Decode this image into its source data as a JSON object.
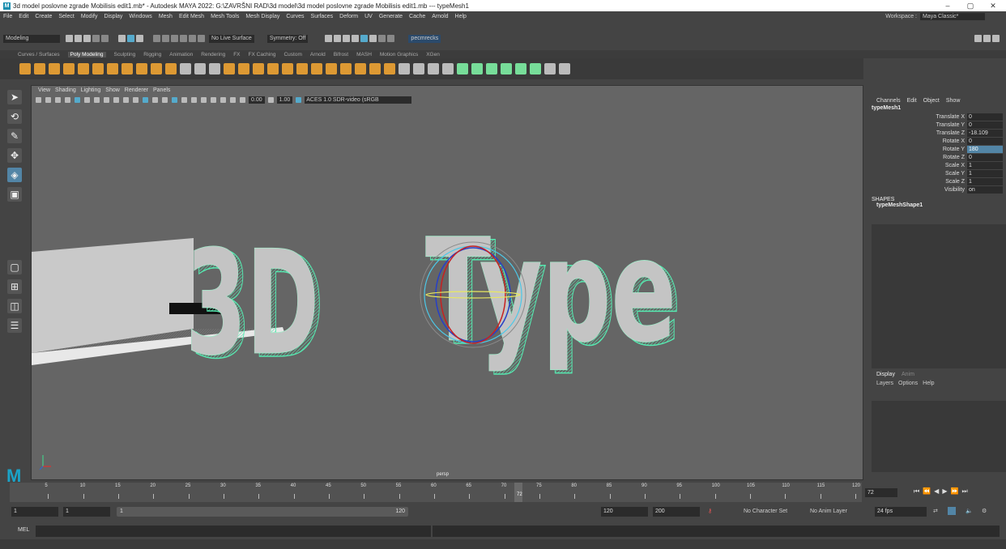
{
  "titlebar": {
    "app_icon": "maya-logo",
    "title": "3d model poslovne zgrade Mobilisis edit1.mb* - Autodesk MAYA 2022: G:\\ZAVRŠNI RAD\\3d model\\3d model poslovne zgrade Mobilisis edit1.mb  ---  typeMesh1",
    "minimize": "–",
    "maximize": "▢",
    "close": "✕"
  },
  "menubar": [
    "File",
    "Edit",
    "Create",
    "Select",
    "Modify",
    "Display",
    "Windows",
    "Mesh",
    "Edit Mesh",
    "Mesh Tools",
    "Mesh Display",
    "Curves",
    "Surfaces",
    "Deform",
    "UV",
    "Generate",
    "Cache",
    "Arnold",
    "Help"
  ],
  "workspace": {
    "label": "Workspace :",
    "value": "Maya Classic*"
  },
  "statusline": {
    "menuset": "Modeling",
    "live_surface": "No Live Surface",
    "symmetry": "Symmetry: Off",
    "user": "pecmrecks"
  },
  "shelf_tabs": [
    "Curves / Surfaces",
    "Poly Modeling",
    "Sculpting",
    "Rigging",
    "Animation",
    "Rendering",
    "FX",
    "FX Caching",
    "Custom",
    "Arnold",
    "Bifrost",
    "MASH",
    "Motion Graphics",
    "XGen"
  ],
  "shelf_active": "Poly Modeling",
  "viewport": {
    "menu": [
      "View",
      "Shading",
      "Lighting",
      "Show",
      "Renderer",
      "Panels"
    ],
    "exposure": "0.00",
    "gamma": "1.00",
    "color_space": "ACES 1.0 SDR-video (sRGB",
    "camera": "persp",
    "scene_text": "3D Type"
  },
  "channel_box": {
    "menu": [
      "Channels",
      "Edit",
      "Object",
      "Show"
    ],
    "object": "typeMesh1",
    "attributes": [
      {
        "name": "Translate X",
        "value": "0"
      },
      {
        "name": "Translate Y",
        "value": "0"
      },
      {
        "name": "Translate Z",
        "value": "-18.109"
      },
      {
        "name": "Rotate X",
        "value": "0"
      },
      {
        "name": "Rotate Y",
        "value": "180"
      },
      {
        "name": "Rotate Z",
        "value": "0"
      },
      {
        "name": "Scale X",
        "value": "1"
      },
      {
        "name": "Scale Y",
        "value": "1"
      },
      {
        "name": "Scale Z",
        "value": "1"
      },
      {
        "name": "Visibility",
        "value": "on"
      }
    ],
    "shapes_header": "SHAPES",
    "shape_name": "typeMeshShape1"
  },
  "layer_editor": {
    "tabs": [
      "Display",
      "Anim"
    ],
    "menu": [
      "Layers",
      "Options",
      "Help"
    ]
  },
  "timeline": {
    "ticks": [
      "5",
      "10",
      "15",
      "20",
      "25",
      "30",
      "35",
      "40",
      "45",
      "50",
      "55",
      "60",
      "65",
      "70",
      "75",
      "80",
      "85",
      "90",
      "95",
      "100",
      "105",
      "110",
      "115",
      "120"
    ],
    "current_frame": "72",
    "current_frame_field": "72"
  },
  "range": {
    "start": "1",
    "start_inner": "1",
    "bar_start": "1",
    "bar_end": "120",
    "end_inner": "120",
    "end": "200",
    "character_set": "No Character Set",
    "anim_layer": "No Anim Layer",
    "fps": "24 fps"
  },
  "mel": {
    "label": "MEL"
  },
  "colors": {
    "accent": "#5285a6",
    "mesh_edge": "#57e8b0",
    "viewport_bg": "#656565"
  }
}
